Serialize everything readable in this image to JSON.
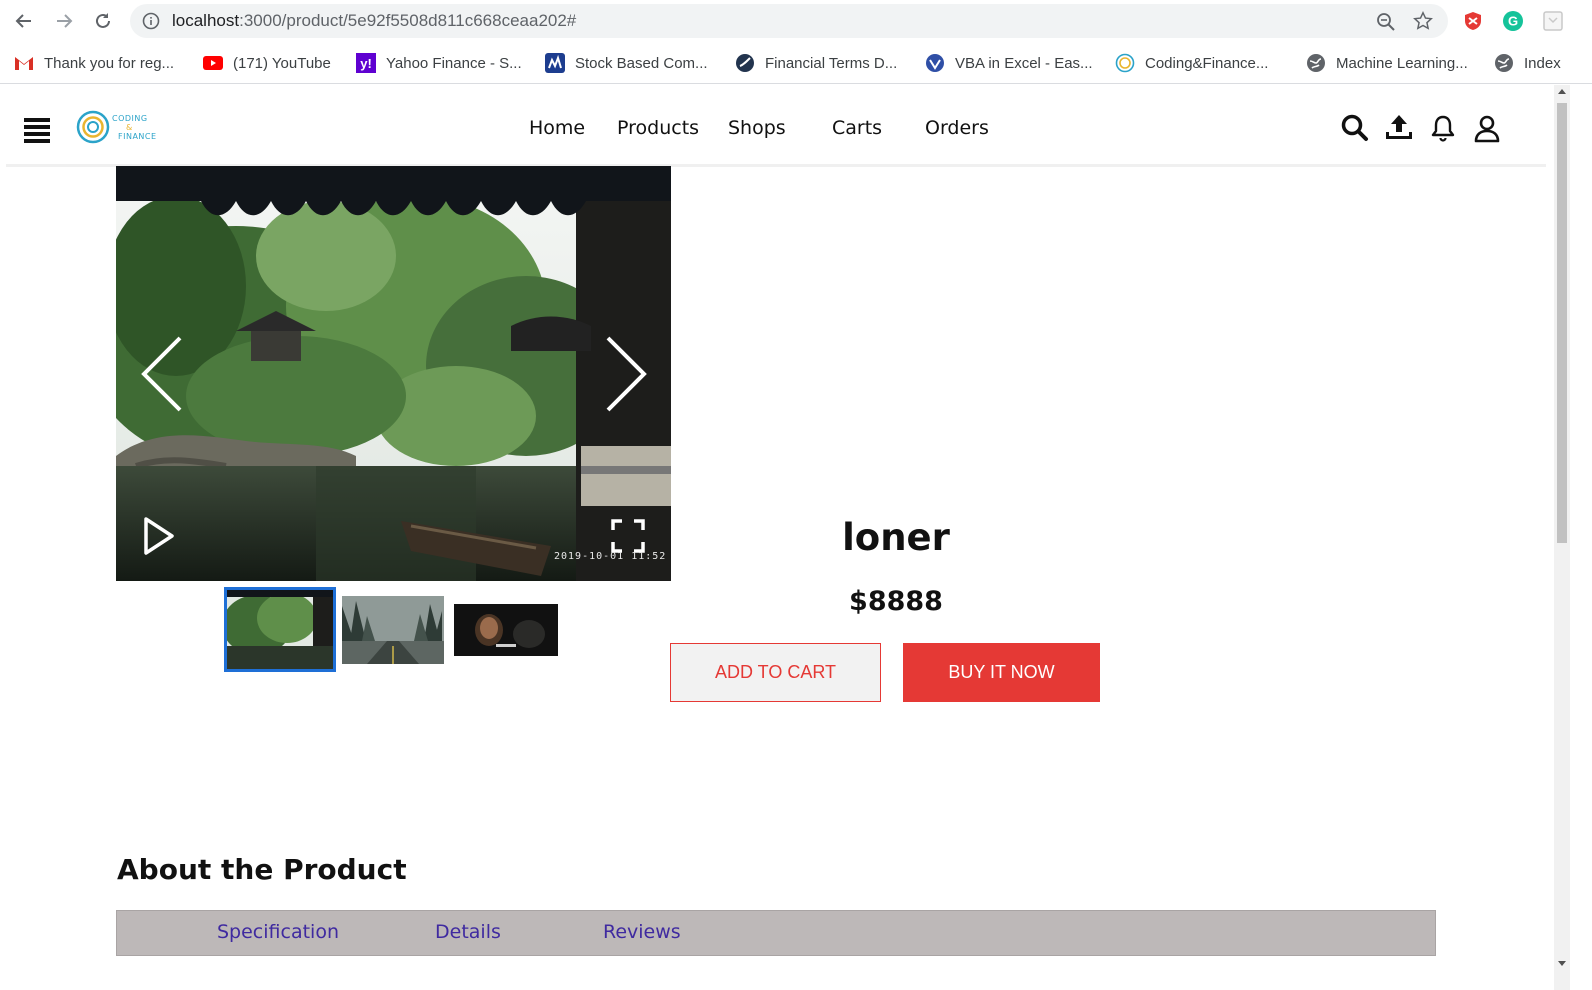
{
  "browser": {
    "url_host": "localhost",
    "url_rest": ":3000/product/5e92f5508d811c668ceaa202#",
    "bookmarks": [
      {
        "label": "Thank you for reg...",
        "icon": "gmail-icon"
      },
      {
        "label": "(171) YouTube",
        "icon": "youtube-icon"
      },
      {
        "label": "Yahoo Finance - S...",
        "icon": "yahoo-icon"
      },
      {
        "label": "Stock Based Com...",
        "icon": "chart-icon"
      },
      {
        "label": "Financial Terms D...",
        "icon": "globe-dark-icon"
      },
      {
        "label": "VBA in Excel - Eas...",
        "icon": "vba-icon"
      },
      {
        "label": "Coding&Finance...",
        "icon": "coding-finance-icon"
      },
      {
        "label": "Machine Learning...",
        "icon": "globe-icon"
      },
      {
        "label": "Index",
        "icon": "globe-icon"
      }
    ]
  },
  "header": {
    "logo_line1": "CODING",
    "logo_line2": "&",
    "logo_line3": "FINANCE",
    "nav": [
      "Home",
      "Products",
      "Shops",
      "Carts",
      "Orders"
    ]
  },
  "gallery": {
    "timestamp": "2019-10-01  11:52",
    "thumbnails": [
      "garden",
      "forest-road",
      "dark-scene"
    ],
    "active_index": 0
  },
  "product": {
    "name": "loner",
    "price": "$8888",
    "add_to_cart": "ADD TO CART",
    "buy_now": "BUY IT NOW"
  },
  "about": {
    "title": "About the Product",
    "tabs": [
      "Specification",
      "Details",
      "Reviews"
    ]
  },
  "colors": {
    "accent_red": "#e53935",
    "tab_text": "#3f2aa0",
    "tab_bar": "#bdb8b8",
    "thumb_active": "#1e6fd6"
  }
}
